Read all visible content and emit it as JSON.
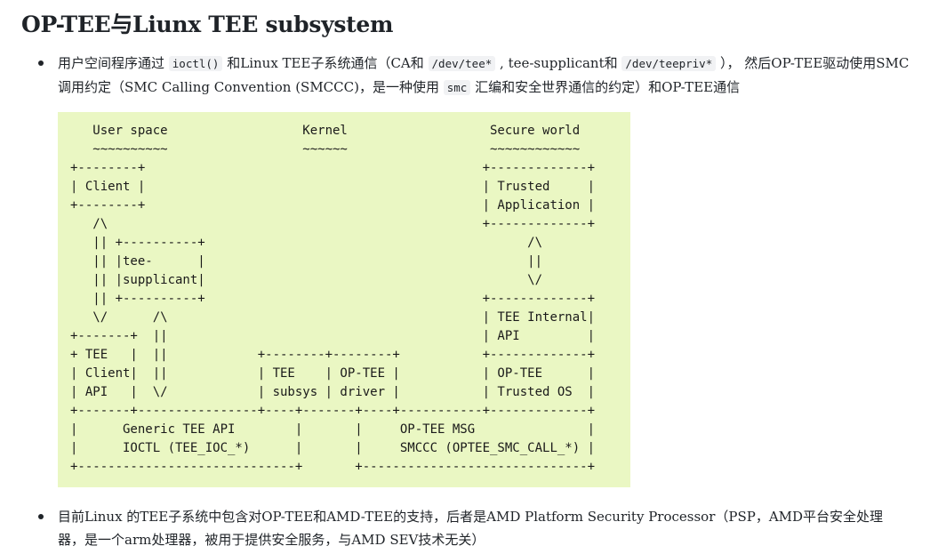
{
  "title": "OP-TEE与Liunx TEE subsystem",
  "bullet1": {
    "t1": "用户空间程序通过 ",
    "c1": "ioctl()",
    "t2": " 和Linux TEE子系统通信（CA和 ",
    "c2": "/dev/tee*",
    "t3": " , tee-supplicant和 ",
    "c3": "/dev/teepriv*",
    "t4": " ）， 然后OP-TEE驱动使用SMC调用约定（SMC Calling Convention (SMCCC)，是一种使用 ",
    "c4": "smc",
    "t5": " 汇编和安全世界通信的约定）和OP-TEE通信"
  },
  "diagram_lines": [
    "   User space                  Kernel                   Secure world",
    "   ~~~~~~~~~~                  ~~~~~~                   ~~~~~~~~~~~~",
    "+--------+                                             +-------------+",
    "| Client |                                             | Trusted     |",
    "+--------+                                             | Application |",
    "   /\\                                                  +-------------+",
    "   || +----------+                                           /\\",
    "   || |tee-      |                                           ||",
    "   || |supplicant|                                           \\/",
    "   || +----------+                                     +-------------+",
    "   \\/      /\\                                          | TEE Internal|",
    "+-------+  ||                                          | API         |",
    "+ TEE   |  ||            +--------+--------+           +-------------+",
    "| Client|  ||            | TEE    | OP-TEE |           | OP-TEE      |",
    "| API   |  \\/            | subsys | driver |           | Trusted OS  |",
    "+-------+----------------+----+-------+----+-----------+-------------+",
    "|      Generic TEE API        |       |     OP-TEE MSG               |",
    "|      IOCTL (TEE_IOC_*)      |       |     SMCCC (OPTEE_SMC_CALL_*) |",
    "+-----------------------------+       +------------------------------+"
  ],
  "bullet2": {
    "text": "目前Linux 的TEE子系统中包含对OP-TEE和AMD-TEE的支持，后者是AMD Platform Security Processor（PSP，AMD平台安全处理器，是一个arm处理器，被用于提供安全服务，与AMD SEV技术无关）"
  }
}
